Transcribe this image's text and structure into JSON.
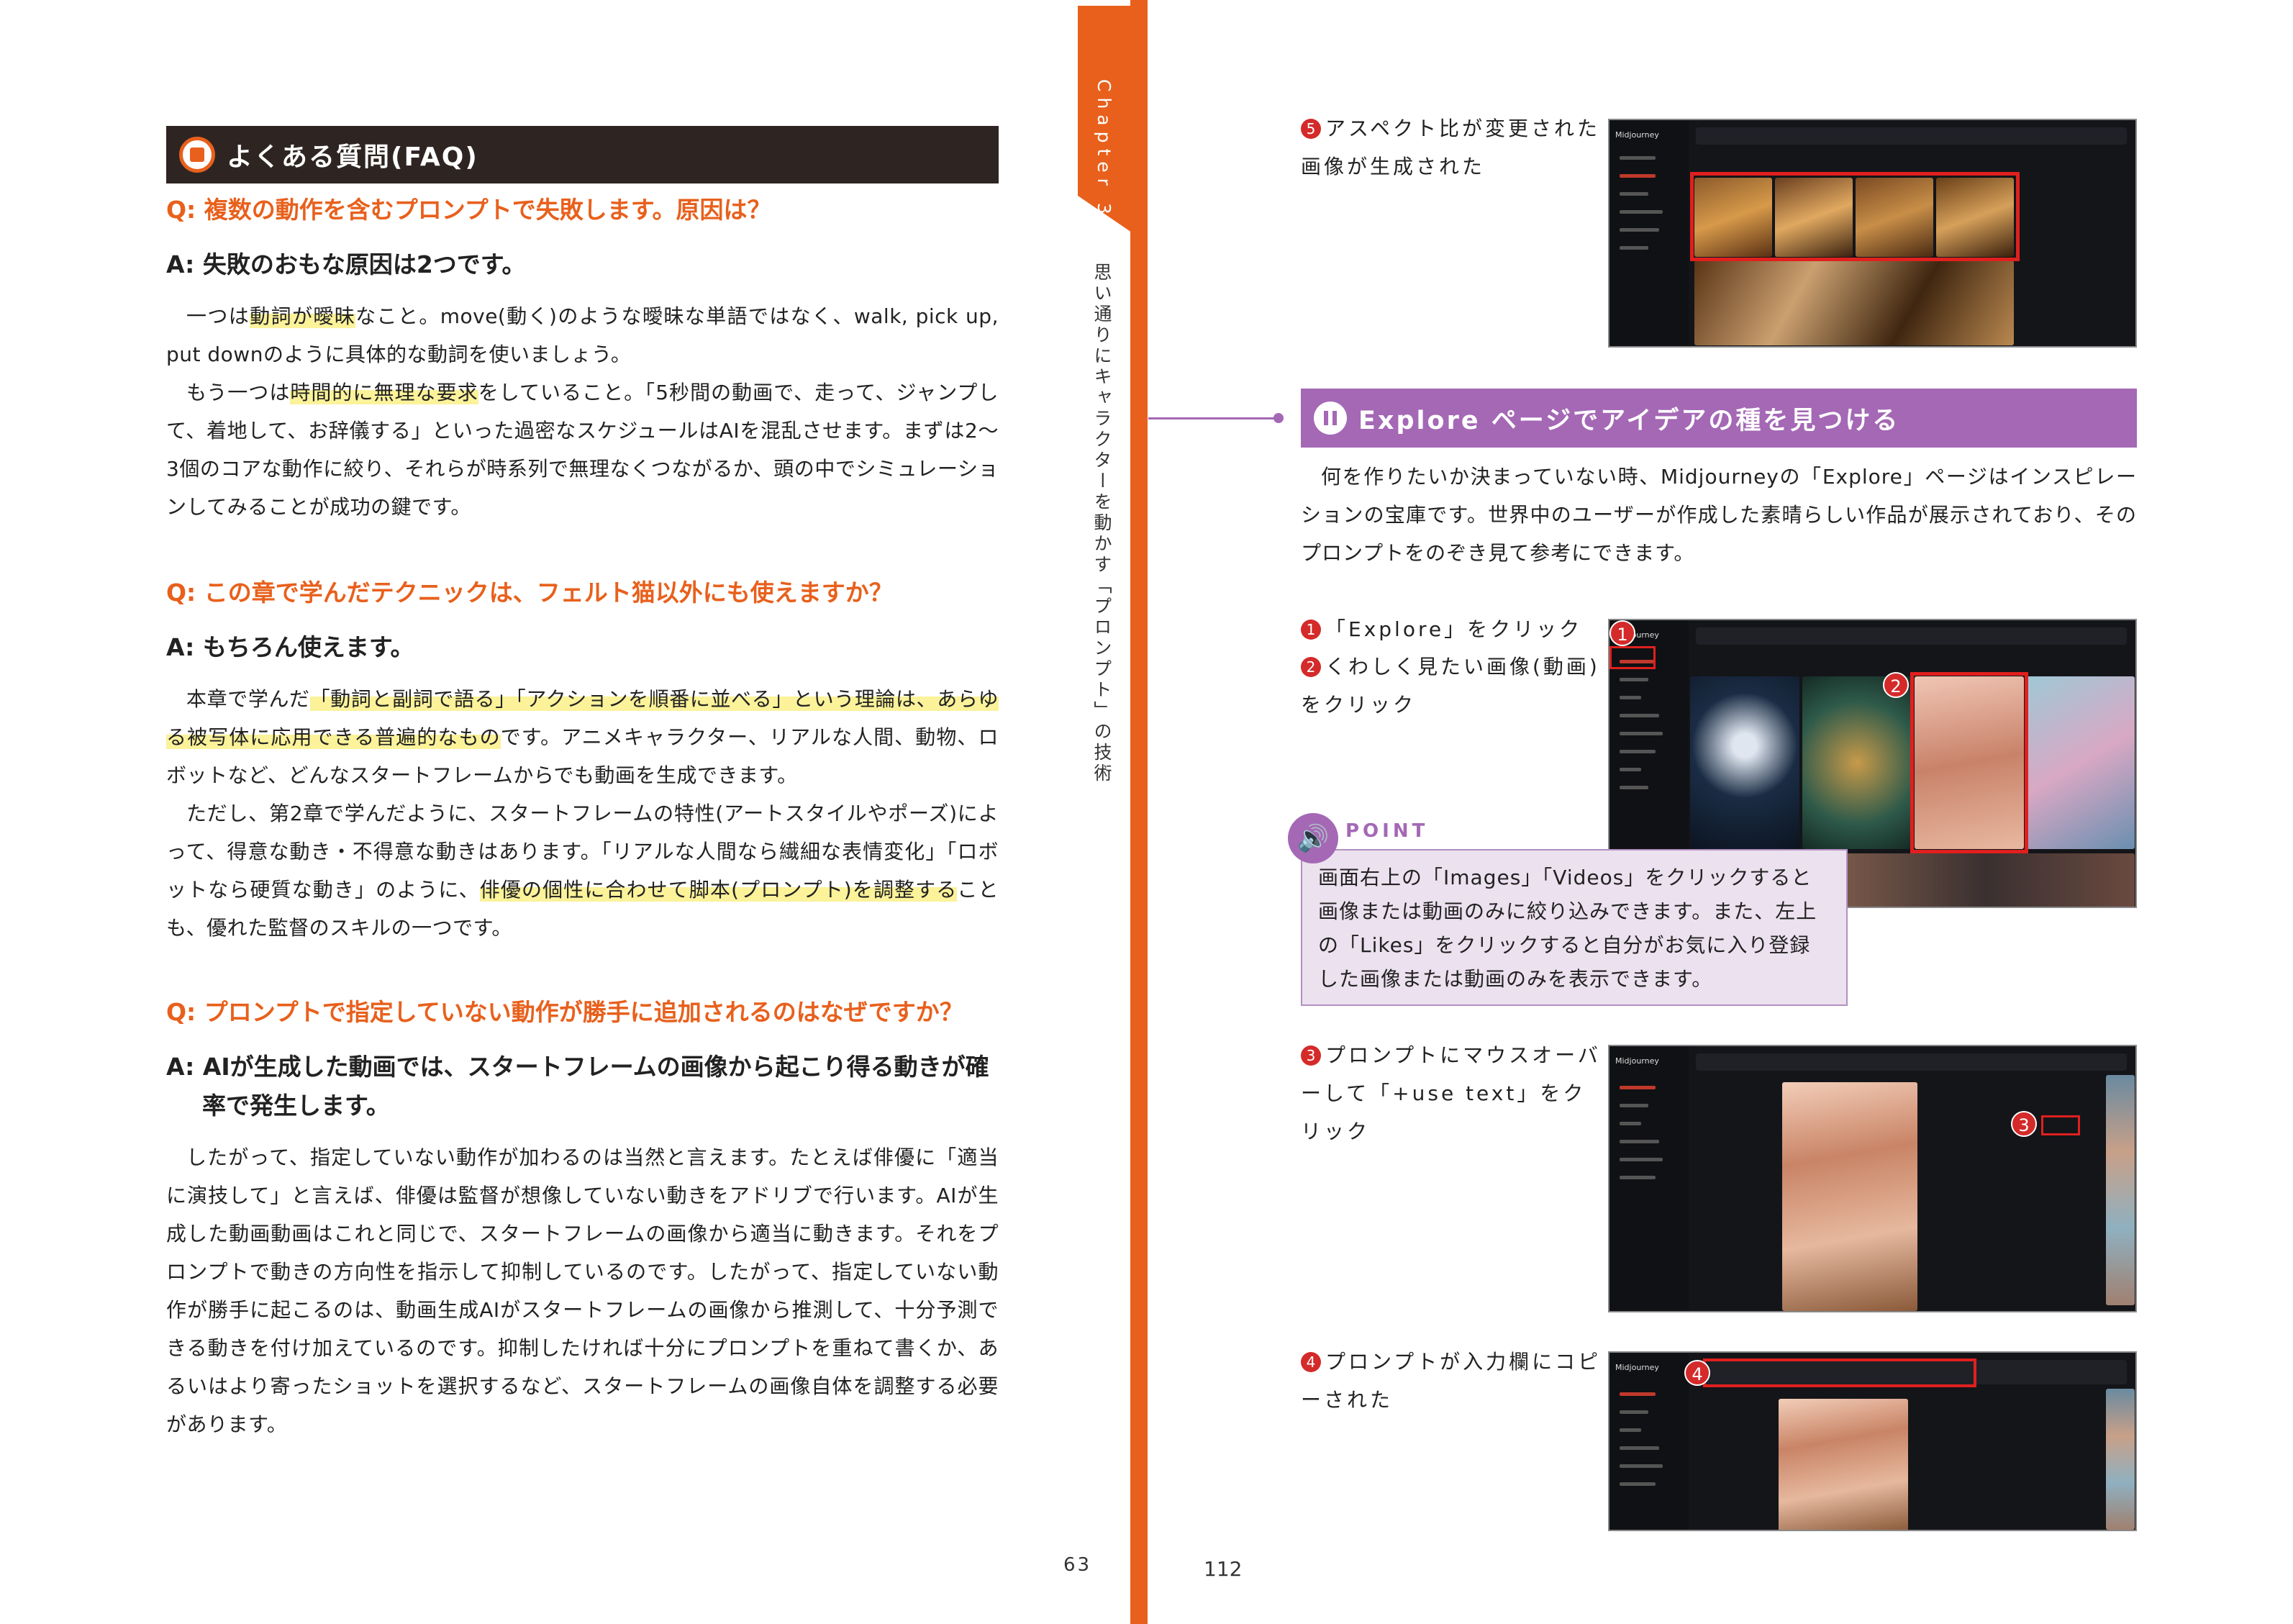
{
  "left": {
    "header": "よくある質問(FAQ)",
    "q1": "Q: 複数の動作を含むプロンプトで失敗します。原因は？",
    "a1": "A: 失敗のおもな原因は2つです。",
    "p1a": "一つは",
    "p1hl": "動詞が曖昧",
    "p1b": "なこと。move(動く)のような曖昧な単語ではなく、walk, pick up, put downのように具体的な動詞を使いましょう。",
    "p2a": "もう一つは",
    "p2hl": "時間的に無理な要求",
    "p2b": "をしていること。「5秒間の動画で、走って、ジャンプして、着地して、お辞儀する」といった過密なスケジュールはAIを混乱させます。まずは2〜3個のコアな動作に絞り、それらが時系列で無理なくつながるか、頭の中でシミュレーションしてみることが成功の鍵です。",
    "q2": "Q: この章で学んだテクニックは、フェルト猫以外にも使えますか？",
    "a2": "A: もちろん使えます。",
    "p3a": "本章で学んだ",
    "p3hl": "「動詞と副詞で語る」「アクションを順番に並べる」という理論は、あらゆる被写体に応用できる普遍的なもの",
    "p3b": "です。アニメキャラクター、リアルな人間、動物、ロボットなど、どんなスタートフレームからでも動画を生成できます。",
    "p4a": "ただし、第2章で学んだように、スタートフレームの特性(アートスタイルやポーズ)によって、得意な動き・不得意な動きはあります。「リアルな人間なら繊細な表情変化」「ロボットなら硬質な動き」のように、",
    "p4hl": "俳優の個性に合わせて脚本(プロンプト)を調整する",
    "p4b": "ことも、優れた監督のスキルの一つです。",
    "q3": "Q: プロンプトで指定していない動作が勝手に追加されるのはなぜですか？",
    "a3": "A: AIが生成した動画では、スタートフレームの画像から起こり得る動きが確率で発生します。",
    "p5": "したがって、指定していない動作が加わるのは当然と言えます。たとえば俳優に「適当に演技して」と言えば、俳優は監督が想像していない動きをアドリブで行います。AIが生成した動画動画はこれと同じで、スタートフレームの画像から適当に動きます。それをプロンプトで動きの方向性を指示して抑制しているのです。したがって、指定していない動作が勝手に起こるのは、動画生成AIがスタートフレームの画像から推測して、十分予測できる動きを付け加えているのです。抑制したければ十分にプロンプトを重ねて書くか、あるいはより寄ったショットを選択するなど、スタートフレームの画像自体を調整する必要があります。",
    "page_number": "63"
  },
  "spine": {
    "chapter": "Chapter 3",
    "subtitle": "思い通りにキャラクターを動かす「プロンプト」の技術"
  },
  "right": {
    "step5_num": "5",
    "step5": "アスペクト比が変更された画像が生成された",
    "explore_header": "Explore ページでアイデアの種を見つける",
    "intro": "何を作りたいか決まっていない時、Midjourneyの「Explore」ページはインスピレーションの宝庫です。世界中のユーザーが作成した素晴らしい作品が展示されており、そのプロンプトをのぞき見て参考にできます。",
    "step1_num": "1",
    "step1": "「Explore」をクリック",
    "step2_num": "2",
    "step2": "くわしく見たい画像(動画)をクリック",
    "point_label": "POINT",
    "point_text": "画面右上の「Images」「Videos」をクリックすると画像または動画のみに絞り込みできます。また、左上の「Likes」をクリックすると自分がお気に入り登録した画像または動画のみを表示できます。",
    "step3_num": "3",
    "step3": "プロンプトにマウスオーバーして「+use text」をクリック",
    "step4_num": "4",
    "step4": "プロンプトが入力欄にコピーされた",
    "badges": [
      "1",
      "2",
      "3",
      "4"
    ],
    "app_name": "Midjourney",
    "page_number": "112"
  },
  "colors": {
    "accent_orange": "#e8601c",
    "accent_purple": "#a468b5",
    "highlight": "#fbf29a",
    "red_box": "#e0201e"
  }
}
